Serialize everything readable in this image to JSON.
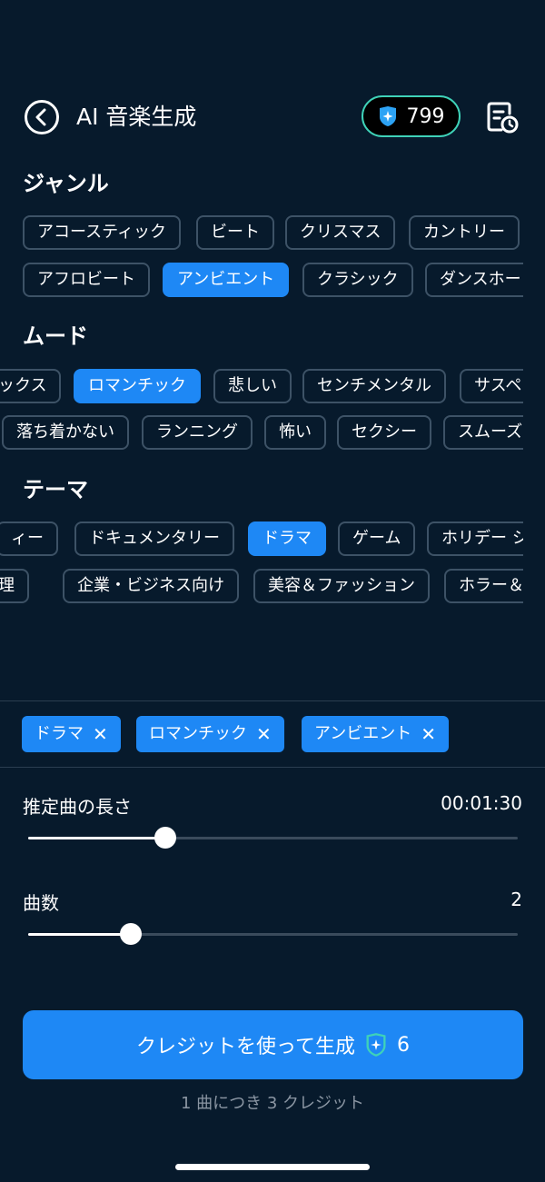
{
  "header": {
    "title": "AI 音楽生成",
    "credits": "799"
  },
  "genre": {
    "title": "ジャンル",
    "row1": [
      "アコースティック",
      "ビート",
      "クリスマス",
      "カントリー"
    ],
    "row2": [
      "アフロビート",
      "アンビエント",
      "クラシック",
      "ダンスホー"
    ]
  },
  "mood": {
    "title": "ムード",
    "row1": [
      "ックス",
      "ロマンチック",
      "悲しい",
      "センチメンタル",
      "サスペ"
    ],
    "row2": [
      "落ち着かない",
      "ランニング",
      "怖い",
      "セクシー",
      "スムーズ"
    ]
  },
  "theme": {
    "title": "テーマ",
    "row1": [
      "ィー",
      "ドキュメンタリー",
      "ドラマ",
      "ゲーム",
      "ホリデー シ"
    ],
    "row2": [
      "理",
      "企業・ビジネス向け",
      "美容＆ファッション",
      "ホラー＆"
    ]
  },
  "selected_tags": [
    "ドラマ",
    "ロマンチック",
    "アンビエント"
  ],
  "length": {
    "label": "推定曲の長さ",
    "value": "00:01:30",
    "fraction": 0.28
  },
  "count": {
    "label": "曲数",
    "value": "2",
    "fraction": 0.21
  },
  "generate": {
    "label": "クレジットを使って生成",
    "cost": "6",
    "note": "1 曲につき 3 クレジット"
  },
  "colors": {
    "accent": "#1e88f5",
    "background": "#071a2c",
    "credit_border": "#3fd2b8"
  }
}
